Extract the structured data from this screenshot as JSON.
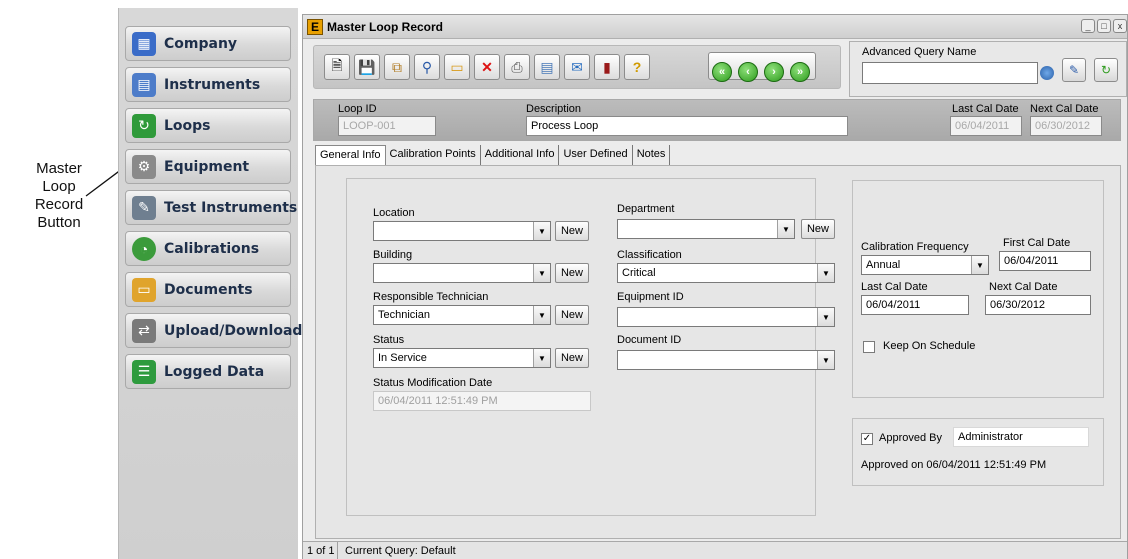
{
  "callout": {
    "lines": [
      "Master",
      "Loop",
      "Record",
      "Button"
    ]
  },
  "sidebar": {
    "items": [
      {
        "label": "Company",
        "icon": "building-icon"
      },
      {
        "label": "Instruments",
        "icon": "calculator-icon"
      },
      {
        "label": "Loops",
        "icon": "loop-icon"
      },
      {
        "label": "Equipment",
        "icon": "gears-icon"
      },
      {
        "label": "Test Instruments",
        "icon": "probe-icon"
      },
      {
        "label": "Calibrations",
        "icon": "gauge-icon"
      },
      {
        "label": "Documents",
        "icon": "folder-icon"
      },
      {
        "label": "Upload/Download",
        "icon": "transfer-icon"
      },
      {
        "label": "Logged Data",
        "icon": "spreadsheet-icon"
      }
    ]
  },
  "window": {
    "title": "Master Loop Record",
    "app_icon_letter": "E",
    "controls": [
      "_",
      "□",
      "x"
    ]
  },
  "toolbar": {
    "buttons": [
      "new-icon",
      "save-icon",
      "copy-icon",
      "search-icon",
      "folder-open-icon",
      "delete-icon",
      "print-icon",
      "export-icon",
      "email-icon",
      "book-icon",
      "help-icon"
    ],
    "nav": [
      "first-icon",
      "previous-icon",
      "next-icon",
      "last-icon"
    ]
  },
  "advanced_query": {
    "label": "Advanced Query Name",
    "value": ""
  },
  "header": {
    "loop_id_label": "Loop ID",
    "loop_id_value": "LOOP-001",
    "description_label": "Description",
    "description_value": "Process Loop",
    "last_cal_label": "Last Cal Date",
    "last_cal_value": "06/04/2011",
    "next_cal_label": "Next Cal Date",
    "next_cal_value": "06/30/2012"
  },
  "tabs": [
    "General Info",
    "Calibration Points",
    "Additional Info",
    "User Defined",
    "Notes"
  ],
  "general": {
    "location_label": "Location",
    "location_value": "",
    "building_label": "Building",
    "building_value": "",
    "technician_label": "Responsible Technician",
    "technician_value": "Technician",
    "status_label": "Status",
    "status_value": "In Service",
    "status_mod_label": "Status Modification Date",
    "status_mod_value": "06/04/2011 12:51:49 PM",
    "department_label": "Department",
    "department_value": "",
    "classification_label": "Classification",
    "classification_value": "Critical",
    "equipment_label": "Equipment ID",
    "equipment_value": "",
    "document_label": "Document ID",
    "document_value": "",
    "new_label": "New"
  },
  "calibration": {
    "frequency_label": "Calibration Frequency",
    "frequency_value": "Annual",
    "first_cal_label": "First Cal Date",
    "first_cal_value": "06/04/2011",
    "last_cal_label": "Last Cal Date",
    "last_cal_value": "06/04/2011",
    "next_cal_label": "Next Cal Date",
    "next_cal_value": "06/30/2012",
    "keep_schedule_label": "Keep On Schedule",
    "keep_schedule_checked": false
  },
  "approval": {
    "approved_by_label": "Approved By",
    "approved_by_checked": true,
    "approved_by_value": "Administrator",
    "approved_on_text": "Approved on 06/04/2011 12:51:49 PM"
  },
  "statusbar": {
    "record": "1 of 1",
    "query": "Current Query: Default"
  },
  "colors": {
    "nav_green": "#2e9b1e",
    "delete_red": "#d11",
    "label_navy": "#1e2f4a"
  }
}
